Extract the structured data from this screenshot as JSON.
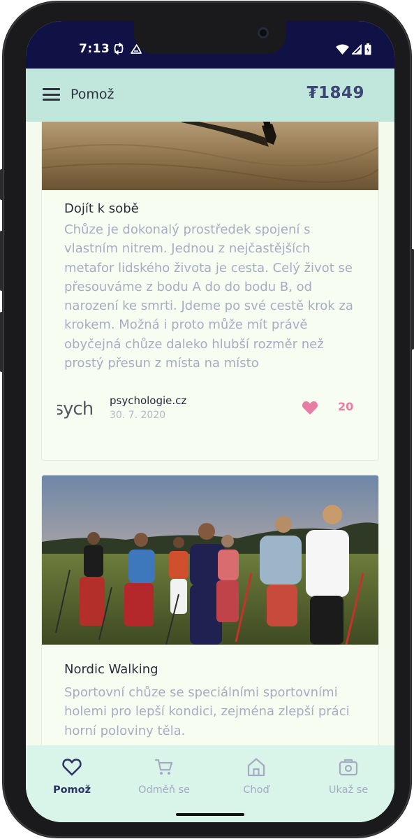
{
  "status_bar": {
    "time": "7:13",
    "left_icons": [
      "sync-icon",
      "data-saver-icon"
    ],
    "right_icons": [
      "wifi-icon",
      "signal-icon",
      "battery-icon"
    ]
  },
  "app_bar": {
    "menu_icon": "menu-icon",
    "title": "Pomož",
    "balance": "₮1849"
  },
  "articles": [
    {
      "title": "Dojít k sobě",
      "body": "Chůze je dokonalý prostředek spojení s vlastním nitrem. Jednou z nejčastějších metafor lidského života je cesta. Celý život se přesouváme z bodu A do do bodu B, od narození ke smrti. Jdeme po své cestě krok za krokem. Možná i proto může mít právě obyčejná chůze daleko hlubší rozměr než prostý přesun z místa na místo",
      "source_logo_text": "psychologie",
      "source_name": "psychologie.cz",
      "date": "30. 7. 2020",
      "likes": "20"
    },
    {
      "title": "Nordic Walking",
      "body": "Sportovní chůze se speciálními sportovními holemi pro lepší kondici, zejména zlepší práci horní poloviny těla."
    }
  ],
  "bottom_nav": [
    {
      "label": "Pomož",
      "icon": "heart-icon",
      "active": true
    },
    {
      "label": "Odměň se",
      "icon": "cart-icon",
      "active": false
    },
    {
      "label": "Choď",
      "icon": "home-icon",
      "active": false
    },
    {
      "label": "Ukaž se",
      "icon": "camera-icon",
      "active": false
    }
  ],
  "colors": {
    "status_bar": "#101246",
    "app_bar": "#c1e7dc",
    "accent_pink": "#e97ca2",
    "nav_active": "#2d3466"
  }
}
